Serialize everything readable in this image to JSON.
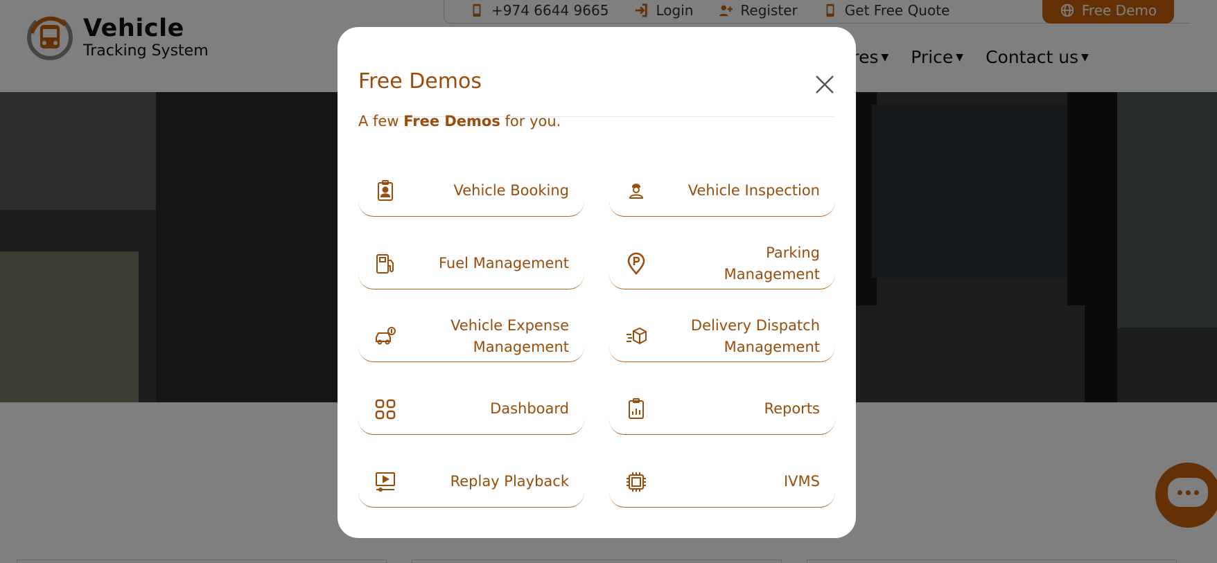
{
  "brand": {
    "title": "Vehicle",
    "subtitle": "Tracking System",
    "accent": "#c8620f",
    "text_accent": "#9a4d0a"
  },
  "topbar": {
    "phone": "+974 6644 9665",
    "login": "Login",
    "register": "Register",
    "quote": "Get Free Quote",
    "demo": "Free Demo"
  },
  "nav": {
    "features": "Features",
    "price": "Price",
    "contact": "Contact us"
  },
  "modal": {
    "title": "Free Demos",
    "intro_prefix": "A few ",
    "intro_bold": "Free Demos",
    "intro_suffix": " for you.",
    "items": [
      {
        "label": "Vehicle Booking",
        "icon": "clipboard-user-icon"
      },
      {
        "label": "Vehicle Inspection",
        "icon": "inspector-icon"
      },
      {
        "label": "Fuel Management",
        "icon": "fuel-pump-icon"
      },
      {
        "label": "Parking Management",
        "icon": "parking-pin-icon"
      },
      {
        "label": "Vehicle Expense Management",
        "icon": "car-dollar-icon"
      },
      {
        "label": "Delivery Dispatch Management",
        "icon": "dispatch-box-icon"
      },
      {
        "label": "Dashboard",
        "icon": "grid-icon"
      },
      {
        "label": "Reports",
        "icon": "report-clipboard-icon"
      },
      {
        "label": "Replay Playback",
        "icon": "playback-screen-icon"
      },
      {
        "label": "IVMS",
        "icon": "chip-icon"
      }
    ]
  }
}
